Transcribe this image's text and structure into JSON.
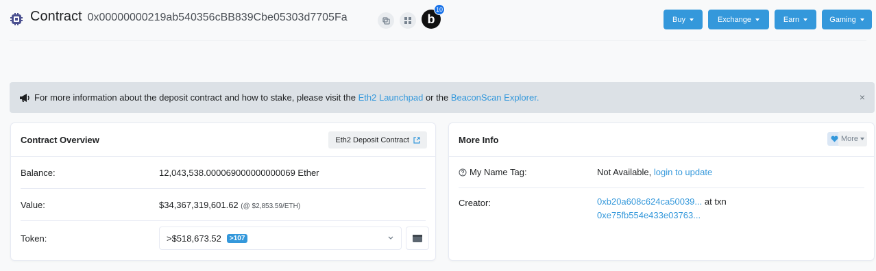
{
  "header": {
    "title": "Contract",
    "address": "0x00000000219ab540356cBB839Cbe05303d7705Fa",
    "b_letter": "b",
    "b_badge": "10",
    "nav": [
      {
        "label": "Buy"
      },
      {
        "label": "Exchange"
      },
      {
        "label": "Earn"
      },
      {
        "label": "Gaming"
      }
    ]
  },
  "alert": {
    "text_before": "For more information about the deposit contract and how to stake, please visit the",
    "link1": "Eth2 Launchpad",
    "text_mid": "or the",
    "link2": "BeaconScan Explorer.",
    "close": "×"
  },
  "overview": {
    "title": "Contract Overview",
    "tag_button": "Eth2 Deposit Contract",
    "balance_label": "Balance:",
    "balance_value": "12,043,538.000069000000000069 Ether",
    "value_label": "Value:",
    "value_value": "$34,367,319,601.62",
    "value_rate": "(@ $2,853.59/ETH)",
    "token_label": "Token:",
    "token_value": ">$518,673.52",
    "token_badge": ">107"
  },
  "more_info": {
    "title": "More Info",
    "more_label": "More",
    "name_tag_label": "My Name Tag:",
    "name_tag_value": "Not Available,",
    "name_tag_link": "login to update",
    "creator_label": "Creator:",
    "creator_addr": "0xb20a608c624ca50039...",
    "creator_at": "at txn",
    "creator_txn": "0xe75fb554e433e03763..."
  },
  "colors": {
    "accent": "#3498db",
    "alert_bg": "#dce1e6"
  }
}
